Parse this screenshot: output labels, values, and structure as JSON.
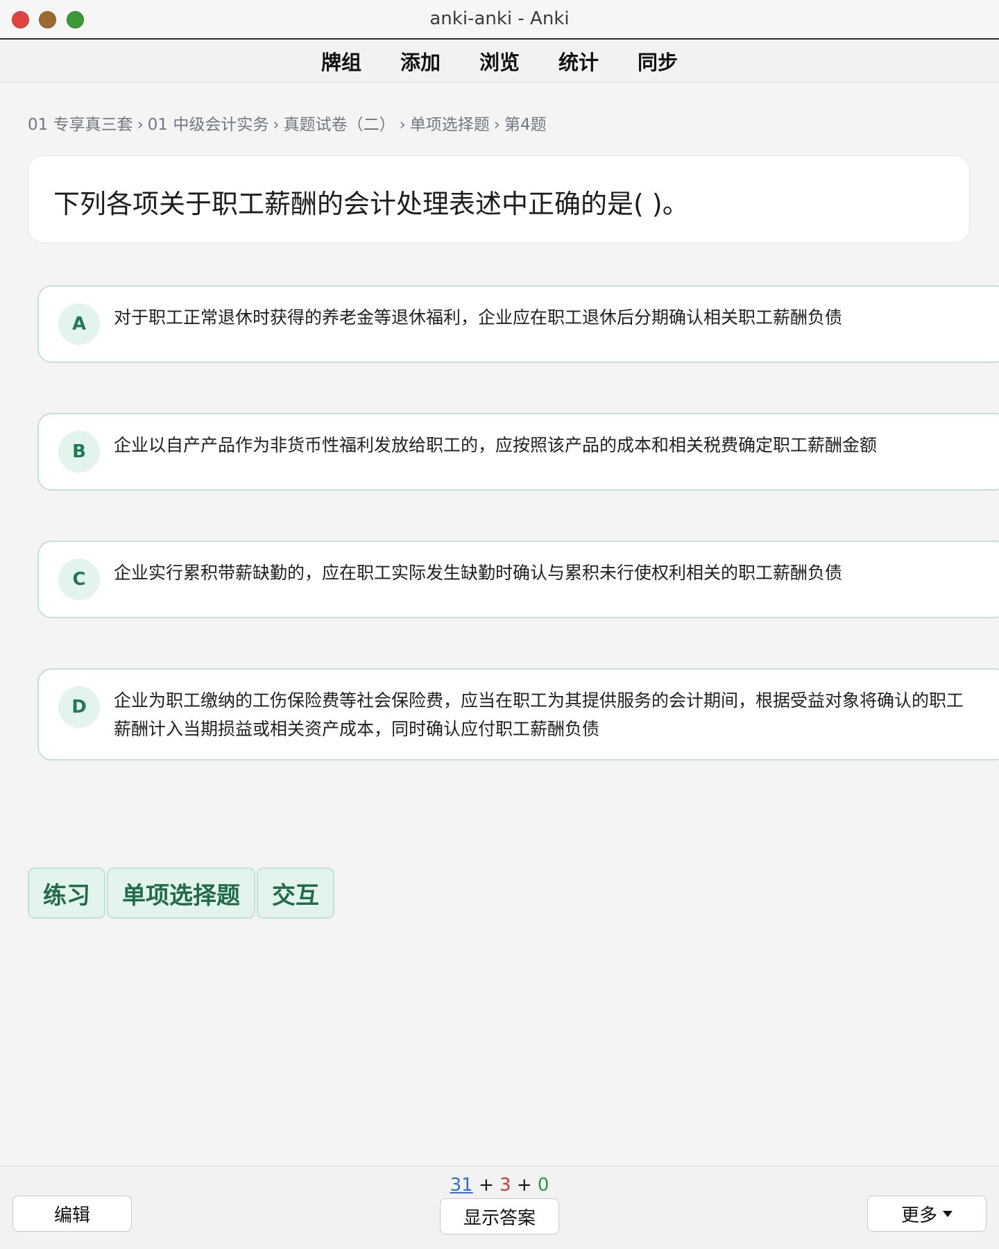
{
  "window": {
    "title": "anki-anki - Anki"
  },
  "topmenu": {
    "items": [
      "牌组",
      "添加",
      "浏览",
      "统计",
      "同步"
    ]
  },
  "breadcrumb": {
    "items": [
      "01 专享真三套",
      "01 中级会计实务",
      "真题试卷（二）",
      "单项选择题",
      "第4题"
    ],
    "separator": "›"
  },
  "question": {
    "text": "下列各项关于职工薪酬的会计处理表述中正确的是( )。"
  },
  "options": [
    {
      "letter": "A",
      "text": "对于职工正常退休时获得的养老金等退休福利，企业应在职工退休后分期确认相关职工薪酬负债"
    },
    {
      "letter": "B",
      "text": "企业以自产产品作为非货币性福利发放给职工的，应按照该产品的成本和相关税费确定职工薪酬金额"
    },
    {
      "letter": "C",
      "text": "企业实行累积带薪缺勤的，应在职工实际发生缺勤时确认与累积未行使权利相关的职工薪酬负债"
    },
    {
      "letter": "D",
      "line1": "企业为职工缴纳的工伤保险费等社会保险费，应当在职工为其提供服务的会计期间，根据受益对象将确认的职工",
      "line2": "薪酬计入当期损益或相关资产成本，同时确认应付职工薪酬负债"
    }
  ],
  "tags": [
    "练习",
    "单项选择题",
    "交互"
  ],
  "bottom": {
    "edit_label": "编辑",
    "show_answer_label": "显示答案",
    "more_label": "更多",
    "counts": {
      "new": "31",
      "learn": "3",
      "review": "0",
      "plus": "+"
    }
  },
  "colors": {
    "accent_green": "#1f7a55",
    "option_border": "#bfe3d4",
    "new_count": "#2f6fd6",
    "learn_count": "#d23a2f",
    "review_count": "#2b9a3e"
  }
}
